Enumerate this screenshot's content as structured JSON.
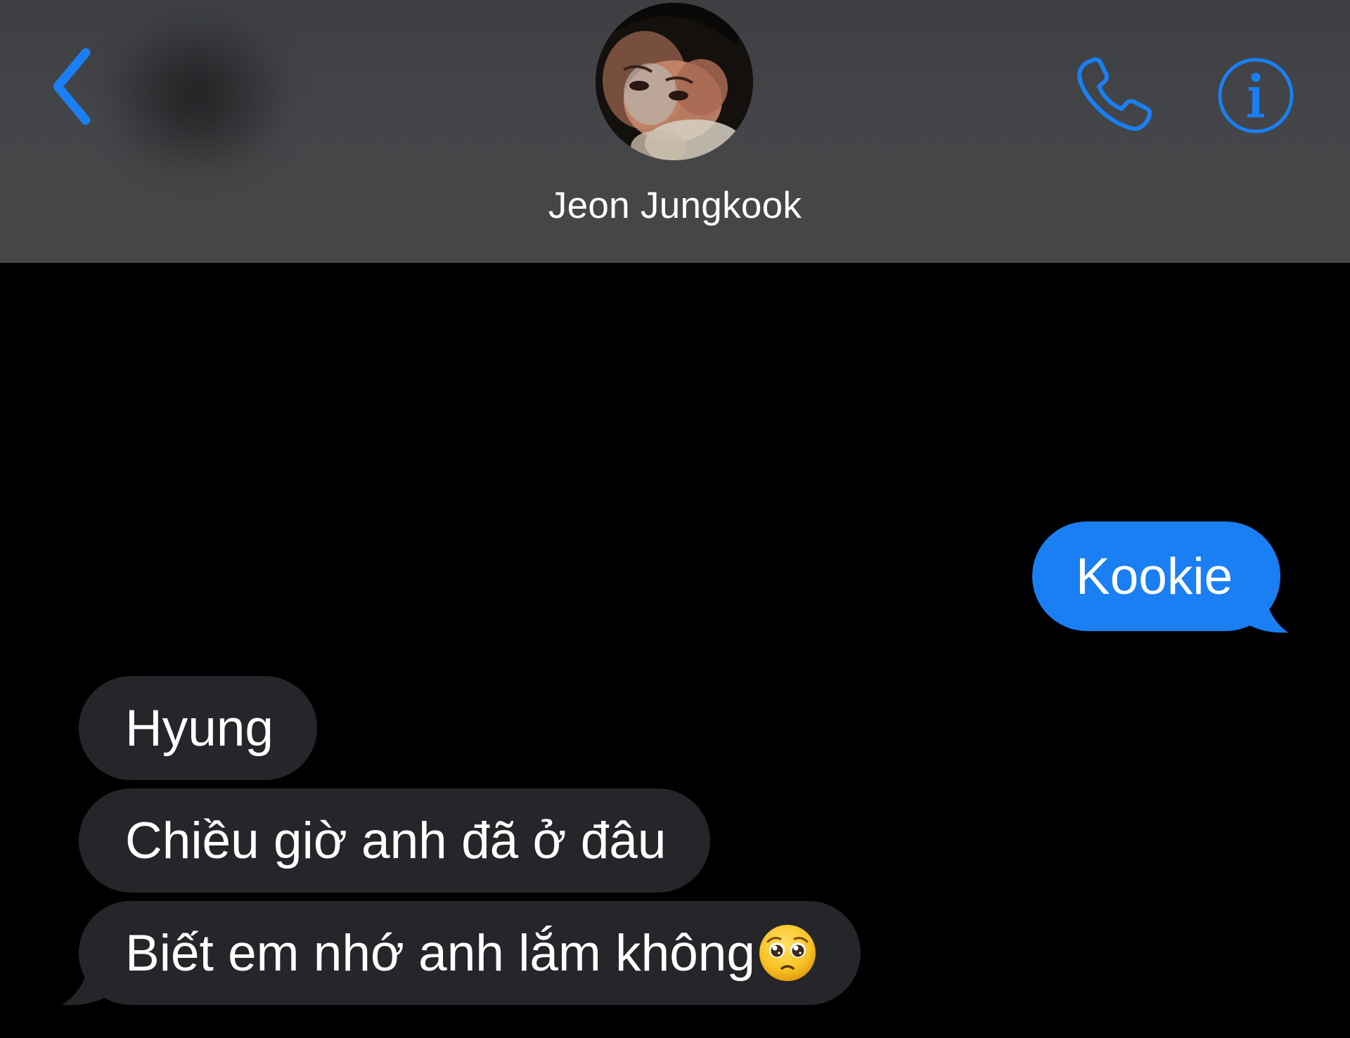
{
  "header": {
    "contact_name": "Jeon Jungkook",
    "back_icon": "chevron-left-icon",
    "call_icon": "phone-icon",
    "info_icon": "info-icon"
  },
  "messages": [
    {
      "direction": "outgoing",
      "text": "Kookie"
    },
    {
      "direction": "incoming",
      "text": "Hyung"
    },
    {
      "direction": "incoming",
      "text": "Chiều giờ anh đã ở đâu"
    },
    {
      "direction": "incoming",
      "text": "Biết em nhớ anh lắm không",
      "emoji": "pleading-face-emoji"
    }
  ],
  "colors": {
    "accent": "#1a7ff3",
    "incoming_bubble": "#26252a",
    "header_bg": "#434548",
    "background": "#000000"
  }
}
